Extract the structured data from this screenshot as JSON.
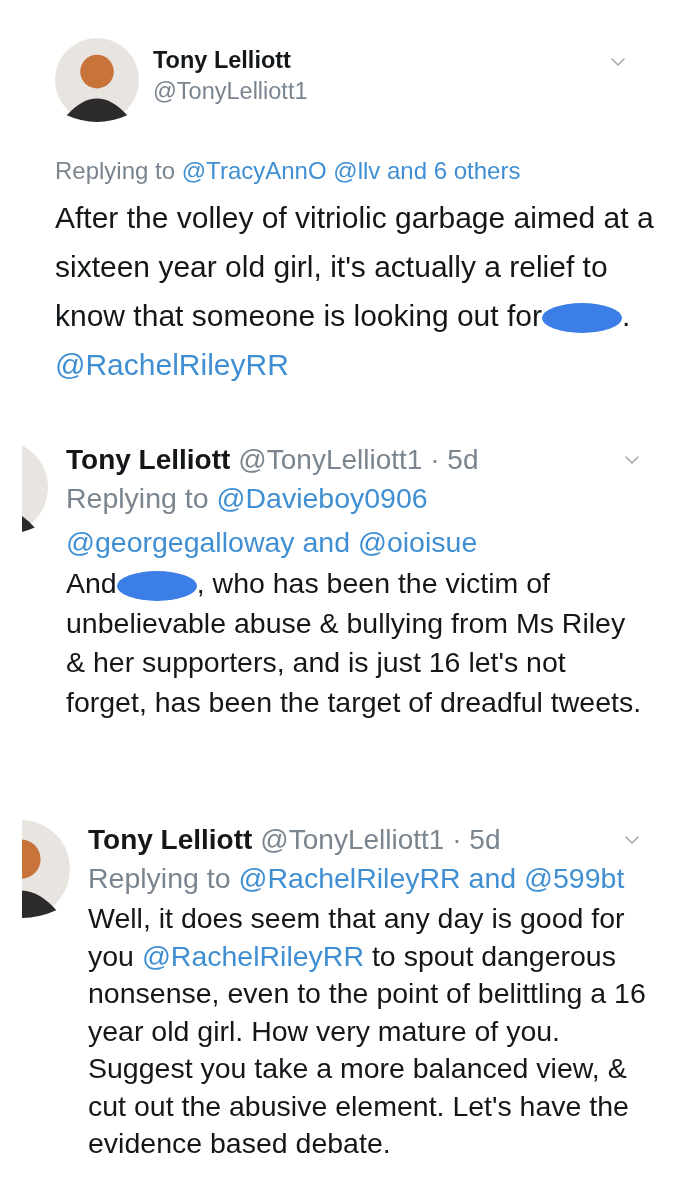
{
  "tweets": [
    {
      "kind": "detail",
      "name": "Tony Lelliott",
      "meta": "@TonyLelliott1",
      "replying": {
        "label": "Replying to",
        "targets": [
          "@TracyAnnO",
          "@llv",
          "and 6 others"
        ]
      },
      "body": [
        {
          "kind": "text",
          "text": "After the volley of vitriolic garbage aimed at a sixteen year old girl, it's actually a relief to know that someone is looking out for"
        },
        {
          "kind": "redacted"
        },
        {
          "kind": "text",
          "text": ". "
        },
        {
          "kind": "mention",
          "text": "@RachelRileyRR"
        }
      ]
    },
    {
      "kind": "reply",
      "name": "Tony Lelliott",
      "meta": "@TonyLelliott1 · 5d",
      "replying": {
        "label": "Replying to",
        "targets": [
          "@Davieboy0906",
          "@georgegalloway",
          "and",
          "@oioisue"
        ]
      },
      "body": [
        {
          "kind": "text",
          "text": "And"
        },
        {
          "kind": "redacted"
        },
        {
          "kind": "text",
          "text": ", who has been the victim of unbelievable abuse & bullying from Ms Riley & her supporters, and is just 16 let's not forget, has been the target of dreadful tweets."
        }
      ]
    },
    {
      "kind": "reply",
      "name": "Tony Lelliott",
      "meta": "@TonyLelliott1 · 5d",
      "replying": {
        "label": "Replying to",
        "targets": [
          "@RachelRileyRR",
          "and",
          "@599bt"
        ]
      },
      "body": [
        {
          "kind": "text",
          "text": "Well, it does seem that any day is good for you "
        },
        {
          "kind": "mention",
          "text": "@RachelRileyRR"
        },
        {
          "kind": "text",
          "text": " to spout dangerous nonsense, even to the point of belittling a 16 year old girl. How very mature of you. Suggest you take a more balanced view, & cut out the abusive element. Let's have the evidence based debate."
        }
      ]
    }
  ]
}
